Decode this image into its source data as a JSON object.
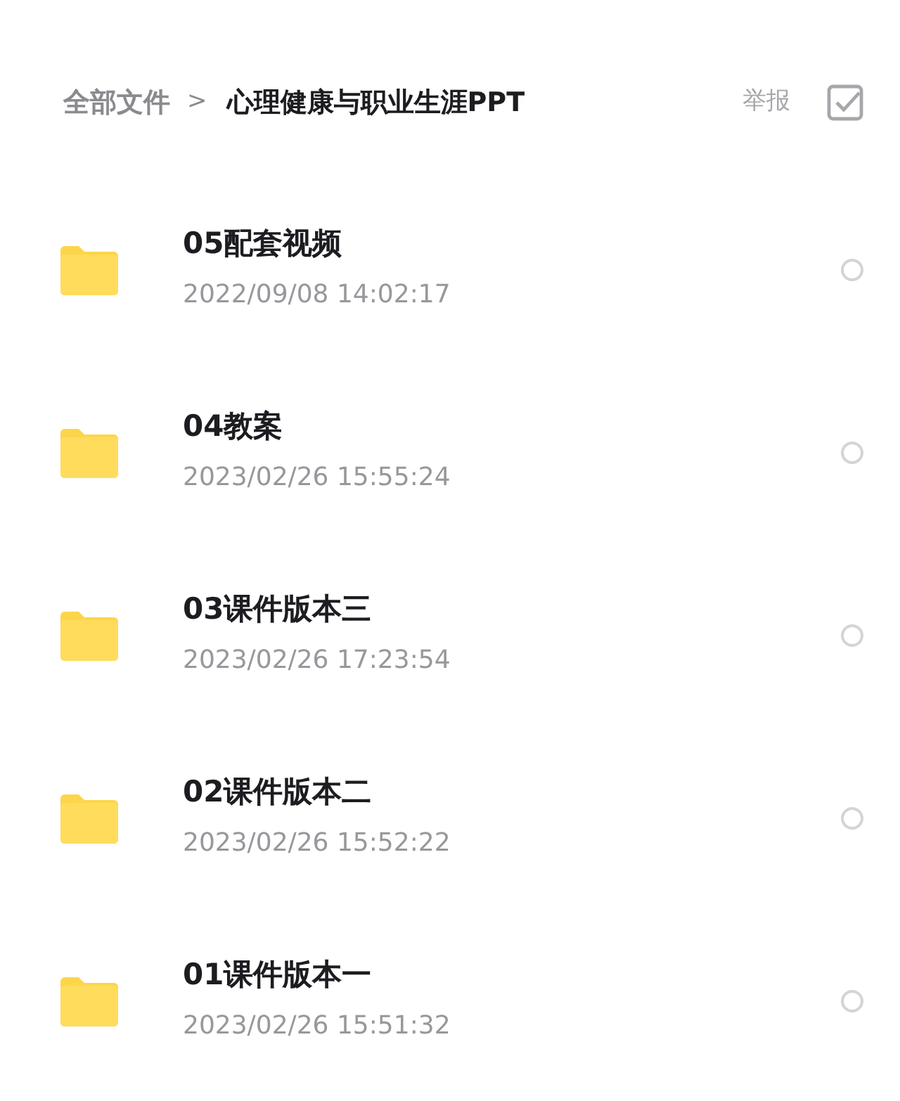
{
  "breadcrumb": {
    "root": "全部文件",
    "separator": ">",
    "current": "心理健康与职业生涯PPT"
  },
  "actions": {
    "report": "举报"
  },
  "files": [
    {
      "name": "05配套视频",
      "modified": "2022/09/08 14:02:17",
      "selected": false
    },
    {
      "name": "04教案",
      "modified": "2023/02/26 15:55:24",
      "selected": false
    },
    {
      "name": "03课件版本三",
      "modified": "2023/02/26 17:23:54",
      "selected": false
    },
    {
      "name": "02课件版本二",
      "modified": "2023/02/26 15:52:22",
      "selected": false
    },
    {
      "name": "01课件版本一",
      "modified": "2023/02/26 15:51:32",
      "selected": false
    }
  ]
}
